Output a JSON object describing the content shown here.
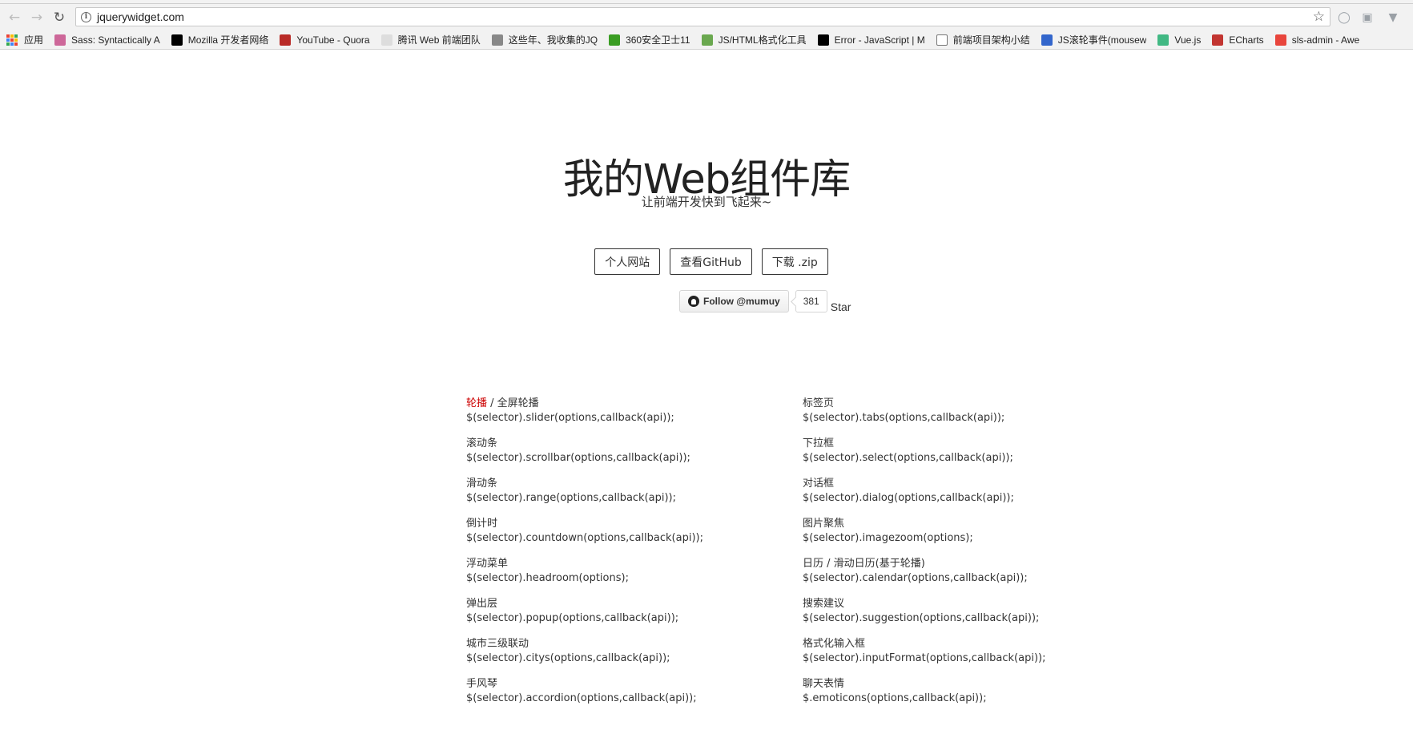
{
  "browser": {
    "url": "jquerywidget.com",
    "bookmarks": [
      {
        "label": "应用",
        "icon": "apps-grid-icon"
      },
      {
        "label": "Sass: Syntactically A",
        "icon": "sass-icon",
        "color": "#cd6799"
      },
      {
        "label": "Mozilla 开发者网络",
        "icon": "mozilla-icon",
        "color": "#000000"
      },
      {
        "label": "YouTube - Quora",
        "icon": "quora-icon",
        "color": "#b92b27"
      },
      {
        "label": "腾讯 Web 前端团队",
        "icon": "egg-icon",
        "color": "#dddddd"
      },
      {
        "label": "这些年、我收集的JQ",
        "icon": "page-icon",
        "color": "#888888"
      },
      {
        "label": "360安全卫士11",
        "icon": "360-icon",
        "color": "#3a9d23"
      },
      {
        "label": "JS/HTML格式化工具",
        "icon": "tool-icon",
        "color": "#6aa84f"
      },
      {
        "label": "Error - JavaScript | M",
        "icon": "mozilla-icon",
        "color": "#000000"
      },
      {
        "label": "前端项目架构小结",
        "icon": "document-icon",
        "color": "#ffffff"
      },
      {
        "label": "JS滚轮事件(mousew",
        "icon": "blog-icon",
        "color": "#3366cc"
      },
      {
        "label": "Vue.js",
        "icon": "vue-icon",
        "color": "#41b883"
      },
      {
        "label": "ECharts",
        "icon": "echarts-icon",
        "color": "#c23531"
      },
      {
        "label": "sls-admin - Awe",
        "icon": "sls-icon",
        "color": "#e8453c"
      }
    ]
  },
  "hero": {
    "title": "我的Web组件库",
    "subtitle": "让前端开发快到飞起来~"
  },
  "buttons": {
    "personal_site": "个人网站",
    "github": "查看GitHub",
    "download": "下载 .zip"
  },
  "github_widget": {
    "follow_label": "Follow @mumuy",
    "count": "381",
    "star_label": "Star"
  },
  "widgets": {
    "left": [
      {
        "title_link": "轮播",
        "title_sep": " / ",
        "title_rest": "全屏轮播",
        "code": "$(selector).slider(options,callback(api));"
      },
      {
        "title": "滚动条",
        "code": "$(selector).scrollbar(options,callback(api));"
      },
      {
        "title": "滑动条",
        "code": "$(selector).range(options,callback(api));"
      },
      {
        "title": "倒计时",
        "code": "$(selector).countdown(options,callback(api));"
      },
      {
        "title": "浮动菜单",
        "code": "$(selector).headroom(options);"
      },
      {
        "title": "弹出层",
        "code": "$(selector).popup(options,callback(api));"
      },
      {
        "title": "城市三级联动",
        "code": "$(selector).citys(options,callback(api));"
      },
      {
        "title": "手风琴",
        "code": "$(selector).accordion(options,callback(api));"
      }
    ],
    "right": [
      {
        "title": "标签页",
        "code": "$(selector).tabs(options,callback(api));"
      },
      {
        "title": "下拉框",
        "code": "$(selector).select(options,callback(api));"
      },
      {
        "title": "对话框",
        "code": "$(selector).dialog(options,callback(api));"
      },
      {
        "title": "图片聚焦",
        "code": "$(selector).imagezoom(options);"
      },
      {
        "title": "日历 / 滑动日历(基于轮播)",
        "code": "$(selector).calendar(options,callback(api));"
      },
      {
        "title": "搜索建议",
        "code": "$(selector).suggestion(options,callback(api));"
      },
      {
        "title": "格式化输入框",
        "code": "$(selector).inputFormat(options,callback(api));"
      },
      {
        "title": "聊天表情",
        "code": "$.emoticons(options,callback(api));"
      }
    ]
  },
  "colors": {
    "accent_link": "#cc0000",
    "text": "#333333"
  }
}
